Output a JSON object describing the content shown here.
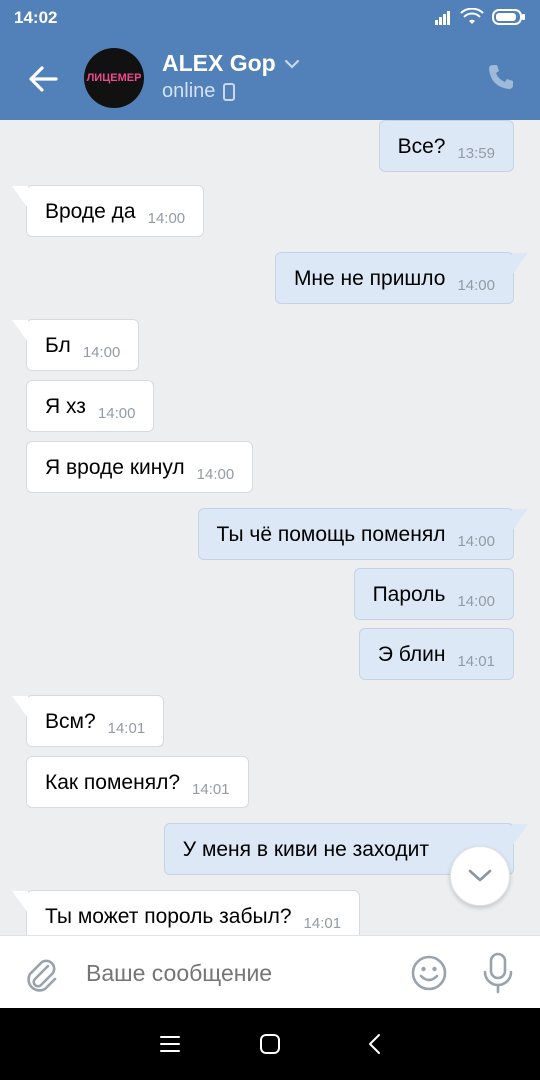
{
  "status": {
    "time": "14:02"
  },
  "header": {
    "name": "ALEX Gop",
    "status": "online",
    "avatar_text": "ЛИЦЕМЕР"
  },
  "messages": [
    {
      "dir": "out",
      "text": "Все?",
      "time": "13:59"
    },
    {
      "dir": "in",
      "text": "Вроде да",
      "time": "14:00"
    },
    {
      "dir": "out",
      "text": "Мне не пришло",
      "time": "14:00"
    },
    {
      "dir": "in",
      "text": "Бл",
      "time": "14:00"
    },
    {
      "dir": "in",
      "text": "Я хз",
      "time": "14:00"
    },
    {
      "dir": "in",
      "text": "Я вроде кинул",
      "time": "14:00"
    },
    {
      "dir": "out",
      "text": "Ты чё помощь поменял",
      "time": "14:00"
    },
    {
      "dir": "out",
      "text": "Пароль",
      "time": "14:00"
    },
    {
      "dir": "out",
      "text": "Э блин",
      "time": "14:01"
    },
    {
      "dir": "in",
      "text": "Всм?",
      "time": "14:01"
    },
    {
      "dir": "in",
      "text": "Как поменял?",
      "time": "14:01"
    },
    {
      "dir": "out",
      "text": "У меня в киви не заходит",
      "time": ""
    },
    {
      "dir": "in",
      "text": "Ты может пороль забыл?",
      "time": "14:01"
    }
  ],
  "composer": {
    "placeholder": "Ваше сообщение"
  },
  "colors": {
    "header": "#5181b8",
    "bg": "#edeef0",
    "outgoing": "#dde8f6",
    "incoming": "#ffffff"
  }
}
